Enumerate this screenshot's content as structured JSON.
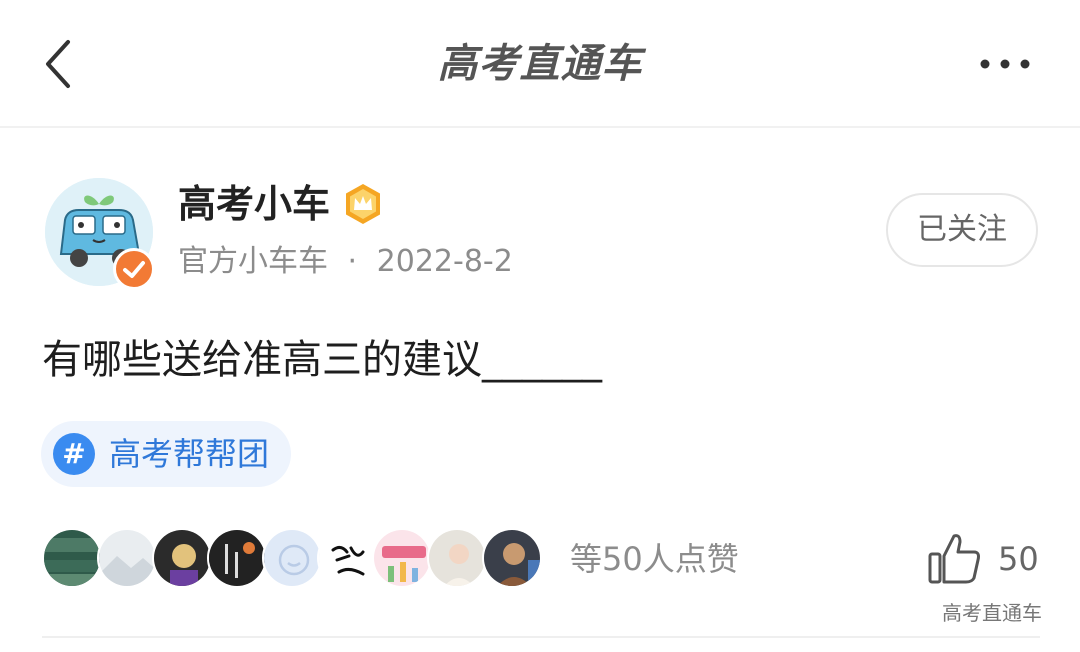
{
  "nav": {
    "title": "高考直通车",
    "back_icon": "chevron-left-icon",
    "more_icon": "more-horizontal-icon"
  },
  "author": {
    "name": "高考小车",
    "subtitle": "官方小车车",
    "separator": "·",
    "date": "2022-8-2",
    "follow_label": "已关注",
    "avatar_icon": "car-mascot-avatar",
    "verified_icon": "verified-check-icon",
    "level_icon": "crown-badge-icon"
  },
  "post": {
    "title": "有哪些送给准高三的建议______"
  },
  "topic": {
    "hash": "#",
    "label": "高考帮帮团"
  },
  "likes": {
    "summary": "等50人点赞",
    "count": "50",
    "thumb_icon": "thumbs-up-icon"
  },
  "watermark": "高考直通车",
  "colors": {
    "accent_blue": "#3a8bf0",
    "topic_text": "#2f78d9",
    "topic_bg": "#eef4fd",
    "verified_orange": "#f27a35",
    "badge_gold": "#f5a623"
  }
}
